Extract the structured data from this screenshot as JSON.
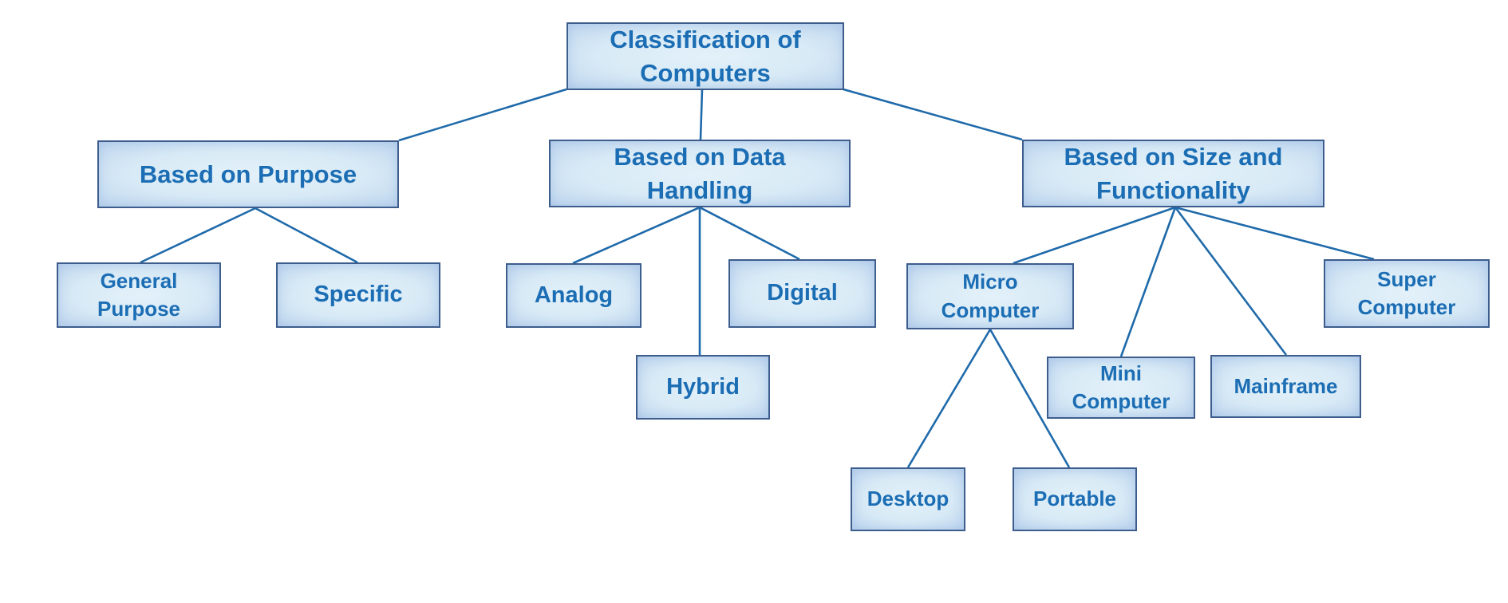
{
  "diagram": {
    "colors": {
      "border": "#3d5d8c",
      "text": "#1b6db4",
      "line": "#1f6aaa",
      "fill": "#dcedf8"
    },
    "nodes": {
      "root": "Classification of\nComputers",
      "purpose": "Based on Purpose",
      "data_handling": "Based on Data\nHandling",
      "size": "Based on Size and\nFunctionality",
      "general": "General\nPurpose",
      "specific": "Specific",
      "analog": "Analog",
      "digital": "Digital",
      "hybrid": "Hybrid",
      "micro": "Micro\nComputer",
      "mini": "Mini\nComputer",
      "mainframe": "Mainframe",
      "super": "Super\nComputer",
      "desktop": "Desktop",
      "portable": "Portable"
    },
    "edges": [
      [
        "root",
        "purpose"
      ],
      [
        "root",
        "data_handling"
      ],
      [
        "root",
        "size"
      ],
      [
        "purpose",
        "general"
      ],
      [
        "purpose",
        "specific"
      ],
      [
        "data_handling",
        "analog"
      ],
      [
        "data_handling",
        "hybrid"
      ],
      [
        "data_handling",
        "digital"
      ],
      [
        "size",
        "micro"
      ],
      [
        "size",
        "mini"
      ],
      [
        "size",
        "mainframe"
      ],
      [
        "size",
        "super"
      ],
      [
        "micro",
        "desktop"
      ],
      [
        "micro",
        "portable"
      ]
    ]
  }
}
